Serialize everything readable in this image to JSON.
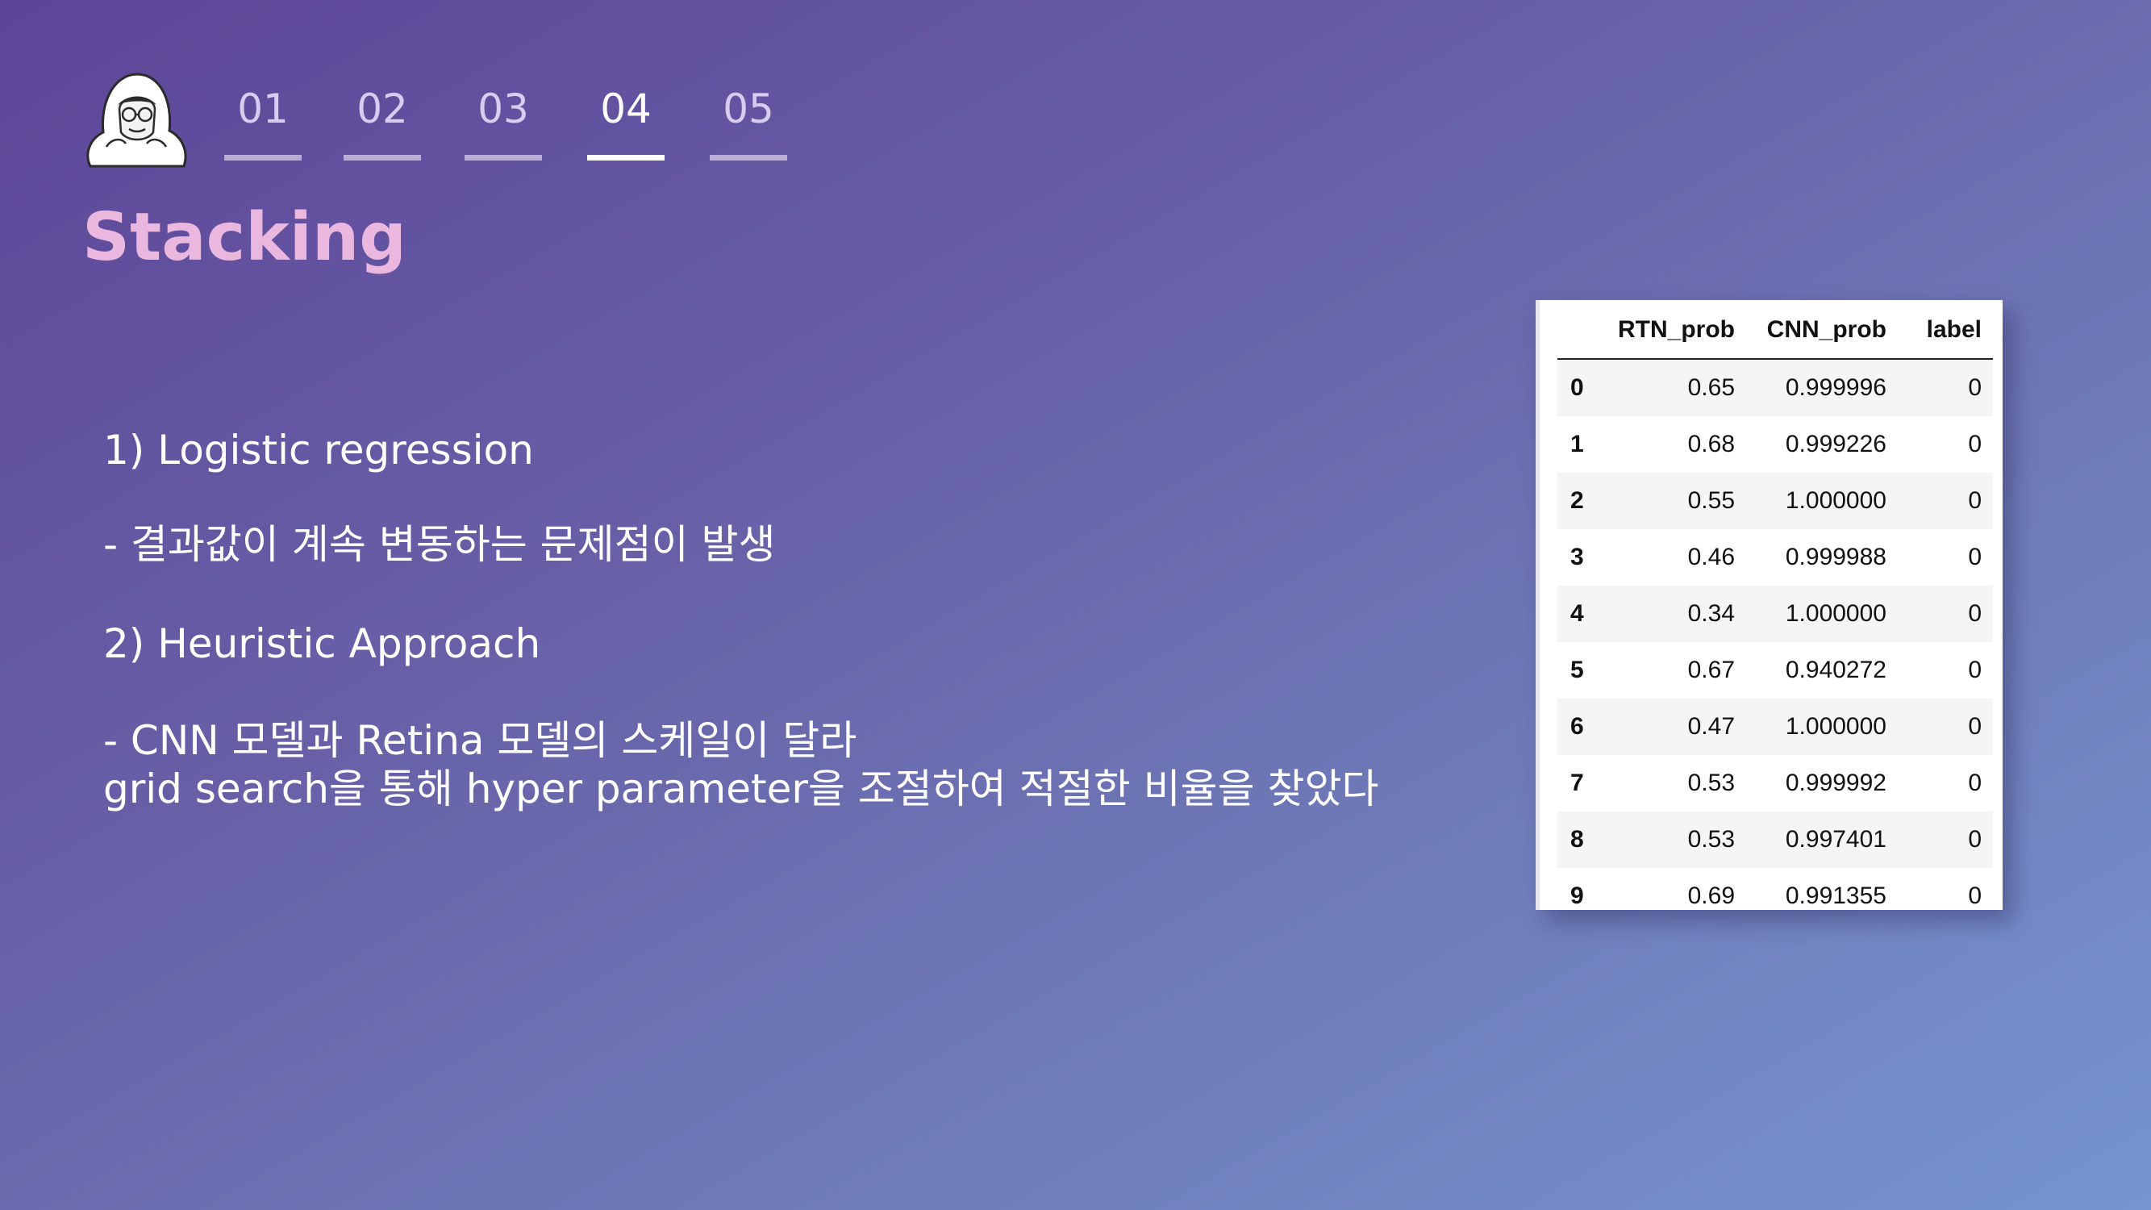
{
  "nav": {
    "items": [
      {
        "label": "01"
      },
      {
        "label": "02"
      },
      {
        "label": "03"
      },
      {
        "label": "04"
      },
      {
        "label": "05"
      }
    ],
    "active_index": 3
  },
  "title": "Stacking",
  "content": {
    "lines": [
      "1)  Logistic regression",
      "- 결과값이 계속 변동하는 문제점이 발생",
      "2) Heuristic Approach",
      "-   CNN 모델과 Retina 모델의 스케일이 달라",
      "grid search을 통해 hyper parameter을 조절하여 적절한 비율을 찾았다"
    ]
  },
  "table": {
    "columns": [
      "",
      "RTN_prob",
      "CNN_prob",
      "label"
    ],
    "rows": [
      [
        "0",
        "0.65",
        "0.999996",
        "0"
      ],
      [
        "1",
        "0.68",
        "0.999226",
        "0"
      ],
      [
        "2",
        "0.55",
        "1.000000",
        "0"
      ],
      [
        "3",
        "0.46",
        "0.999988",
        "0"
      ],
      [
        "4",
        "0.34",
        "1.000000",
        "0"
      ],
      [
        "5",
        "0.67",
        "0.940272",
        "0"
      ],
      [
        "6",
        "0.47",
        "1.000000",
        "0"
      ],
      [
        "7",
        "0.53",
        "0.999992",
        "0"
      ],
      [
        "8",
        "0.53",
        "0.997401",
        "0"
      ],
      [
        "9",
        "0.69",
        "0.991355",
        "0"
      ]
    ]
  },
  "icons": {
    "avatar": "hooded-character-icon"
  },
  "colors": {
    "title": "#eab8df",
    "nav_inactive": "#d7cdf0",
    "nav_active": "#ffffff"
  }
}
